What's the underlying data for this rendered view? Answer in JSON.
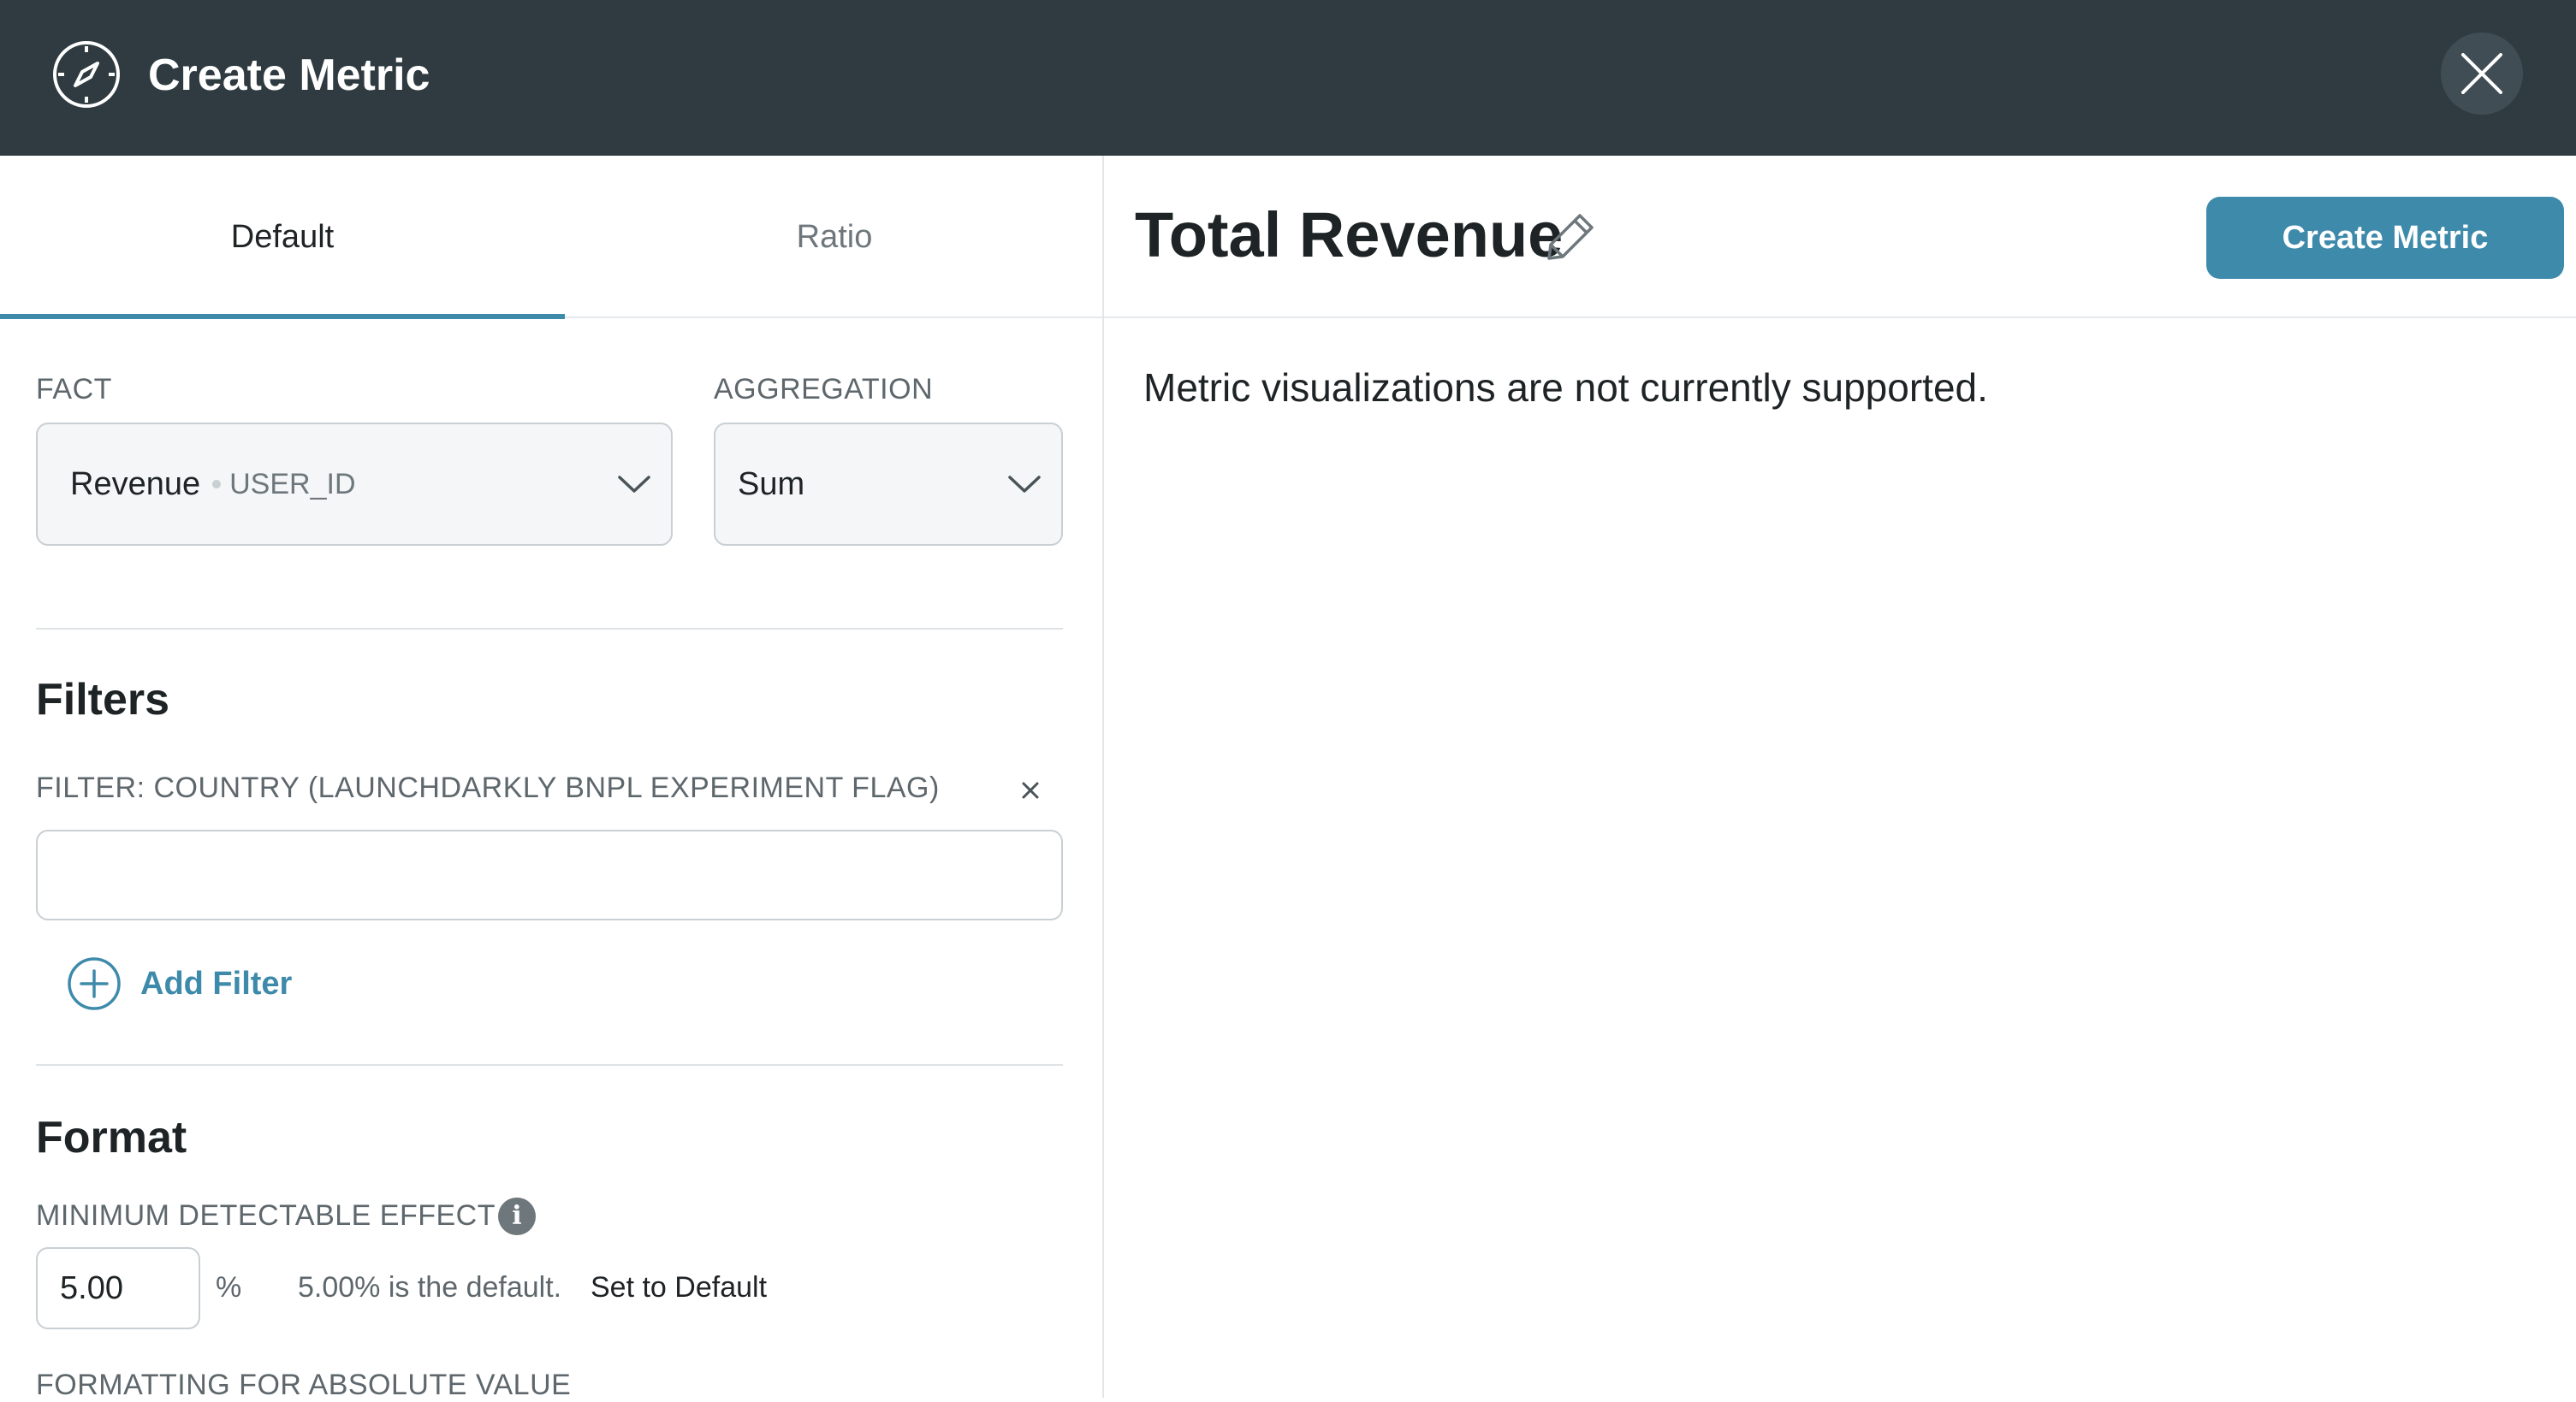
{
  "header": {
    "title": "Create Metric",
    "logo_icon": "compass-icon",
    "close_icon": "close-icon"
  },
  "tabs": [
    {
      "label": "Default",
      "active": true
    },
    {
      "label": "Ratio",
      "active": false
    }
  ],
  "fact": {
    "label": "FACT",
    "value": "Revenue",
    "sub_value": "USER_ID"
  },
  "aggregation": {
    "label": "AGGREGATION",
    "value": "Sum"
  },
  "filters": {
    "title": "Filters",
    "filter_label": "FILTER: COUNTRY (LAUNCHDARKLY BNPL EXPERIMENT FLAG)",
    "filter_value": "",
    "add_label": "Add Filter"
  },
  "format": {
    "title": "Format",
    "mde_label": "MINIMUM DETECTABLE EFFECT",
    "mde_value": "5.00",
    "mde_unit": "%",
    "mde_hint": "5.00% is the default.",
    "set_default_label": "Set to Default",
    "absolute_label": "FORMATTING FOR ABSOLUTE VALUE"
  },
  "metric": {
    "name": "Total Revenue",
    "create_button": "Create Metric",
    "message": "Metric visualizations are not currently supported."
  },
  "colors": {
    "header_bg": "#2f3b41",
    "accent": "#3e8aab"
  }
}
